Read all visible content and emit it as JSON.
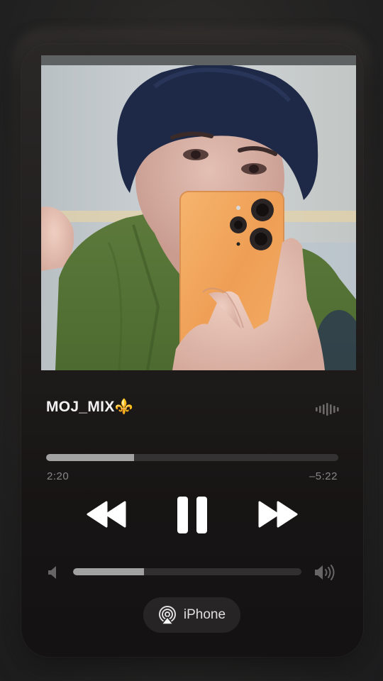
{
  "track": {
    "title": "MOJ_MIX⚜️",
    "progress_fraction": 0.3
  },
  "playback": {
    "elapsed": "2:20",
    "remaining": "–5:22",
    "state": "playing"
  },
  "volume": {
    "level_fraction": 0.31
  },
  "output": {
    "device_label": "iPhone",
    "icon": "airplay-icon"
  },
  "icons": {
    "waveform": "waveform-icon",
    "rewind": "backward-icon",
    "pause": "pause-icon",
    "forward": "forward-icon",
    "volume_low": "speaker-low-icon",
    "volume_high": "speaker-high-icon"
  },
  "colors": {
    "artwork_phone": "#f0a55c",
    "shirt": "#5a7a3a",
    "hair": "#1f2a4a"
  }
}
